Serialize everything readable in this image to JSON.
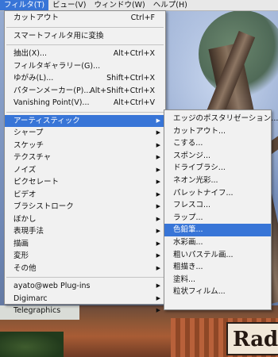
{
  "menubar": {
    "items": [
      {
        "label": "フィルタ(T)",
        "active": true
      },
      {
        "label": "ビュー(V)"
      },
      {
        "label": "ウィンドウ(W)"
      },
      {
        "label": "ヘルプ(H)"
      }
    ]
  },
  "filter_menu": {
    "last_filter": {
      "label": "カットアウト",
      "shortcut": "Ctrl+F"
    },
    "smart_filter": {
      "label": "スマートフィルタ用に変換"
    },
    "extract": {
      "label": "抽出(X)...",
      "shortcut": "Alt+Ctrl+X"
    },
    "gallery": {
      "label": "フィルタギャラリー(G)..."
    },
    "liquify": {
      "label": "ゆがみ(L)...",
      "shortcut": "Shift+Ctrl+X"
    },
    "pattern_maker": {
      "label": "パターンメーカー(P)...",
      "shortcut": "Alt+Shift+Ctrl+X"
    },
    "vanishing_point": {
      "label": "Vanishing Point(V)...",
      "shortcut": "Alt+Ctrl+V"
    },
    "categories": [
      "アーティスティック",
      "シャープ",
      "スケッチ",
      "テクスチャ",
      "ノイズ",
      "ピクセレート",
      "ビデオ",
      "ブラシストローク",
      "ぼかし",
      "表現手法",
      "描画",
      "変形",
      "その他"
    ],
    "plugins": [
      "ayato@web Plug-ins",
      "Digimarc",
      "Telegraphics"
    ]
  },
  "artistic_submenu": {
    "items": [
      "エッジのポスタリゼーション...",
      "カットアウト...",
      "こする...",
      "スポンジ...",
      "ドライブラシ...",
      "ネオン光彩...",
      "パレットナイフ...",
      "フレスコ...",
      "ラップ...",
      "色鉛筆...",
      "水彩画...",
      "粗いパステル画...",
      "粗描き...",
      "塗料...",
      "粒状フィルム..."
    ]
  },
  "background": {
    "sign_text": "Rad"
  },
  "colors": {
    "highlight": "#3875d7",
    "menu_bg": "#f1f1f1"
  }
}
